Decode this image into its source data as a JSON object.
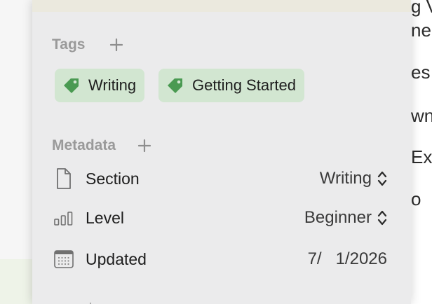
{
  "background_document": {
    "lines": [
      "g V",
      "ner",
      "es",
      "wn",
      "Exp",
      "o"
    ]
  },
  "tags_section": {
    "title": "Tags",
    "add_icon": "plus-icon",
    "tags": [
      {
        "label": "Writing",
        "icon": "tag-icon"
      },
      {
        "label": "Getting Started",
        "icon": "tag-icon"
      }
    ]
  },
  "metadata_section": {
    "title": "Metadata",
    "add_icon": "plus-icon",
    "rows": [
      {
        "label": "Section",
        "value": "Writing",
        "icon": "document-icon"
      },
      {
        "label": "Level",
        "value": "Beginner",
        "icon": "bars-icon"
      },
      {
        "label": "Updated",
        "value": "7/   1/2026",
        "icon": "calendar-icon"
      }
    ]
  },
  "colors": {
    "panel_bg": "#ebebec",
    "tag_bg": "#d2e6d1",
    "tag_icon": "#4a9a52",
    "section_title": "#9a9a9a"
  }
}
